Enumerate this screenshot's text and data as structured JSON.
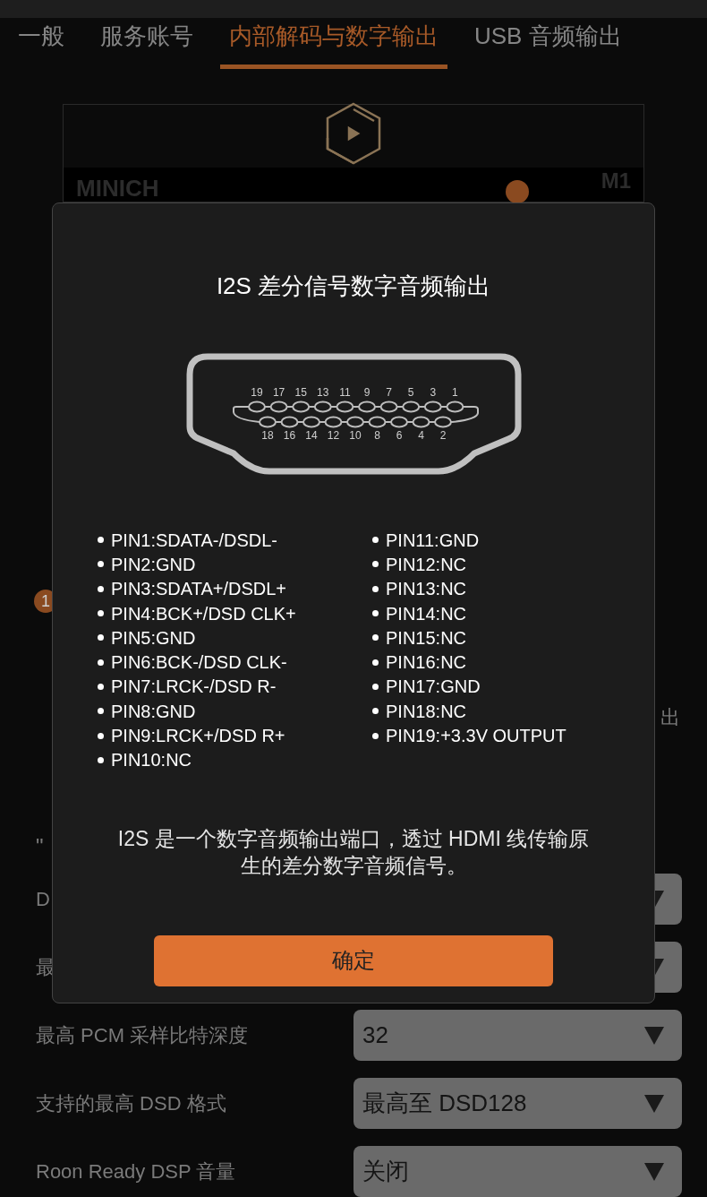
{
  "tabs": [
    {
      "label": "一般",
      "selected": false
    },
    {
      "label": "服务账号",
      "selected": false
    },
    {
      "label": "内部解码与数字输出",
      "selected": true
    },
    {
      "label": "USB 音频输出",
      "selected": false
    }
  ],
  "device_card": {
    "brand": "MINICH",
    "model": "M1"
  },
  "badge": "1",
  "label_fragment": "出",
  "quote_fragment": "\"",
  "settings": [
    {
      "label": "D"
    },
    {
      "label": "最"
    },
    {
      "label": "最高 PCM 采样比特深度",
      "value": "32"
    },
    {
      "label": "支持的最高 DSD 格式",
      "value": "最高至 DSD128"
    },
    {
      "label": "Roon Ready DSP 音量",
      "value": "关闭"
    }
  ],
  "dialog": {
    "title": "I2S 差分信号数字音频输出",
    "connector": {
      "top_pins": [
        "19",
        "17",
        "15",
        "13",
        "11",
        "9",
        "7",
        "5",
        "3",
        "1"
      ],
      "bottom_pins": [
        "18",
        "16",
        "14",
        "12",
        "10",
        "8",
        "6",
        "4",
        "2"
      ]
    },
    "pins_left": [
      "PIN1:SDATA-/DSDL-",
      "PIN2:GND",
      "PIN3:SDATA+/DSDL+",
      "PIN4:BCK+/DSD CLK+",
      "PIN5:GND",
      "PIN6:BCK-/DSD CLK-",
      "PIN7:LRCK-/DSD R-",
      "PIN8:GND",
      "PIN9:LRCK+/DSD R+",
      "PIN10:NC"
    ],
    "pins_right": [
      "PIN11:GND",
      "PIN12:NC",
      "PIN13:NC",
      "PIN14:NC",
      "PIN15:NC",
      "PIN16:NC",
      "PIN17:GND",
      "PIN18:NC",
      "PIN19:+3.3V OUTPUT"
    ],
    "description": "I2S 是一个数字音频输出端口，透过 HDMI 线传输原生的差分数字音频信号。",
    "button": "确定"
  }
}
